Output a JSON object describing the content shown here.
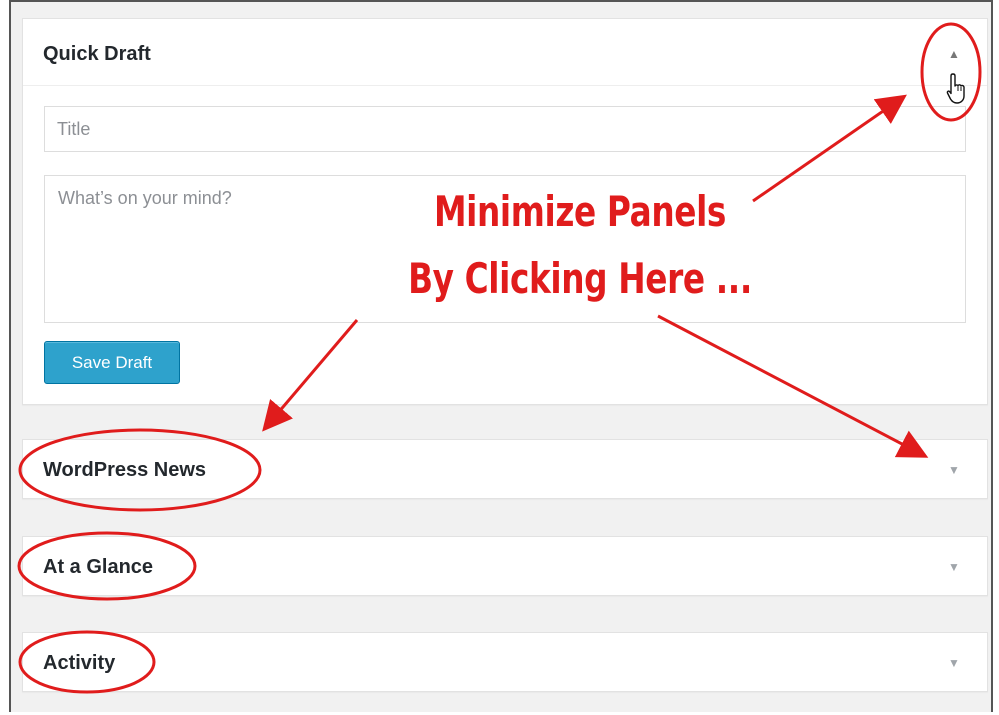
{
  "quick_draft": {
    "title": "Quick Draft",
    "toggle_icon": "triangle-up",
    "title_placeholder": "Title",
    "content_placeholder": "What’s on your mind?",
    "save_label": "Save Draft"
  },
  "panels": {
    "wordpress_news": {
      "title": "WordPress News",
      "toggle_icon": "triangle-down"
    },
    "at_a_glance": {
      "title": "At a Glance",
      "toggle_icon": "triangle-down"
    },
    "activity": {
      "title": "Activity",
      "toggle_icon": "triangle-down"
    }
  },
  "annotation": {
    "line1": "Minimize Panels",
    "line2": "By Clicking Here ...",
    "color": "#e01c1c"
  },
  "colors": {
    "button_bg": "#2ea2cc",
    "panel_bg": "#ffffff",
    "page_bg": "#f1f1f1"
  }
}
